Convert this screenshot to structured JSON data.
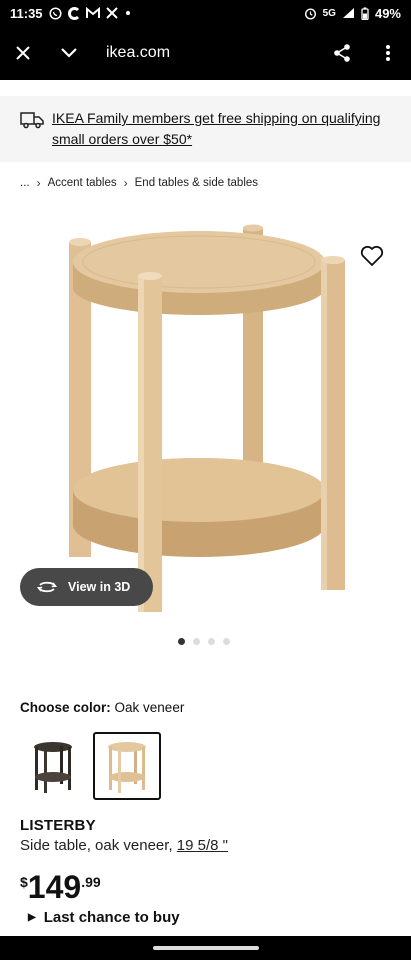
{
  "status_bar": {
    "time": "11:35",
    "notification_icons": [
      "whatsapp-icon",
      "c-app-icon",
      "gmail-icon",
      "x-icon",
      "dot-icon"
    ],
    "network": "5G",
    "battery": "49%"
  },
  "browser": {
    "url": "ikea.com"
  },
  "banner": {
    "text": "IKEA Family members get free shipping on qualifying small orders over $50*"
  },
  "breadcrumb": {
    "ellipsis": "...",
    "items": [
      "Accent tables",
      "End tables & side tables"
    ]
  },
  "product_image": {
    "view_3d_label": "View in 3D",
    "carousel_count": 4,
    "carousel_active": 0
  },
  "color": {
    "label": "Choose color:",
    "value": "Oak veneer",
    "options": [
      "dark-brown",
      "oak-veneer"
    ],
    "selected": "oak-veneer"
  },
  "product": {
    "name": "LISTERBY",
    "description": "Side table, oak veneer,",
    "measure": "19 5/8 \"",
    "price_currency": "$",
    "price_whole": "149",
    "price_cents": ".99",
    "notice": "Last chance to buy"
  },
  "colors": {
    "wood_light": "#e3c79f",
    "wood_mid": "#d9b98c",
    "wood_shade": "#c9a577",
    "dark_wood": "#3b3530",
    "button_bg": "#484848"
  }
}
